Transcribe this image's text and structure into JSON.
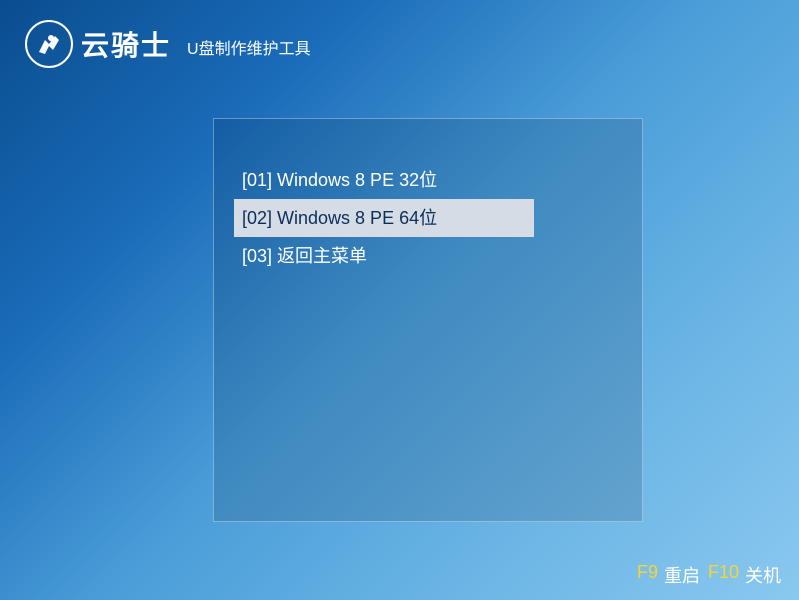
{
  "header": {
    "brand_name": "云骑士",
    "brand_subtitle": "U盘制作维护工具"
  },
  "menu": {
    "items": [
      {
        "label": "[01] Windows 8 PE 32位",
        "selected": false
      },
      {
        "label": "[02] Windows 8 PE 64位",
        "selected": true
      },
      {
        "label": "[03] 返回主菜单",
        "selected": false
      }
    ]
  },
  "footer": {
    "f9_key": "F9",
    "f9_label": "重启",
    "f10_key": "F10",
    "f10_label": "关机"
  }
}
